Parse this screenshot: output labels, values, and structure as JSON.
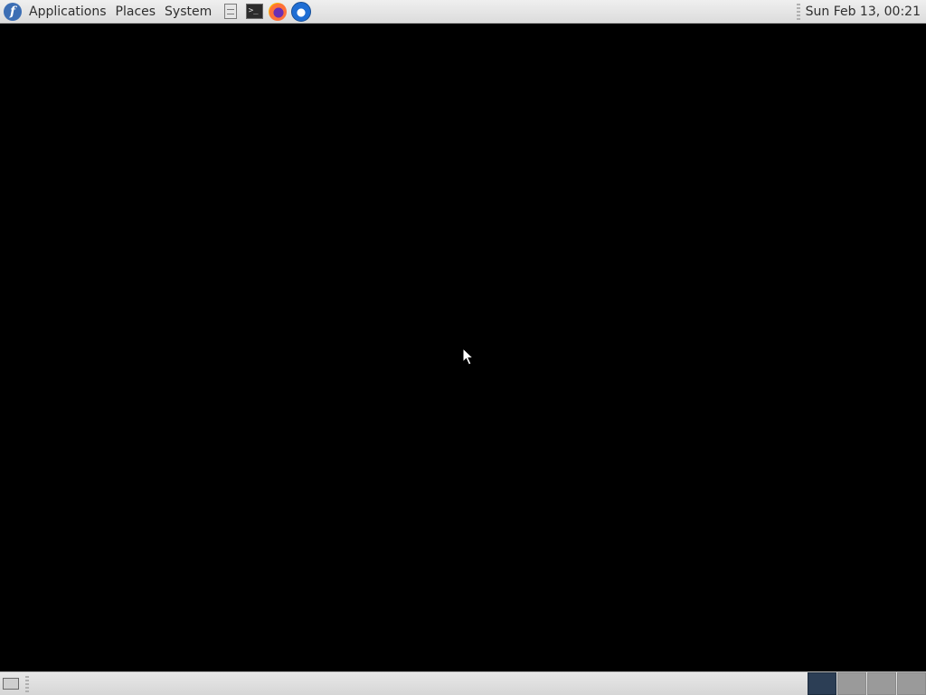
{
  "top_panel": {
    "menus": [
      {
        "label": "Applications"
      },
      {
        "label": "Places"
      },
      {
        "label": "System"
      }
    ],
    "launchers": [
      "file-manager-icon",
      "terminal-icon",
      "firefox-icon",
      "thunderbird-icon"
    ],
    "clock": "Sun Feb 13, 00:21"
  },
  "bottom_panel": {
    "workspaces": [
      {
        "name": "workspace-1",
        "active": true
      },
      {
        "name": "workspace-2",
        "active": false
      },
      {
        "name": "workspace-3",
        "active": false
      },
      {
        "name": "workspace-4",
        "active": false
      }
    ]
  },
  "colors": {
    "desktop_background": "#000000",
    "panel_background": "#e6e6e6",
    "active_workspace": "#2c3e55",
    "inactive_workspace": "#9a9a9a"
  }
}
